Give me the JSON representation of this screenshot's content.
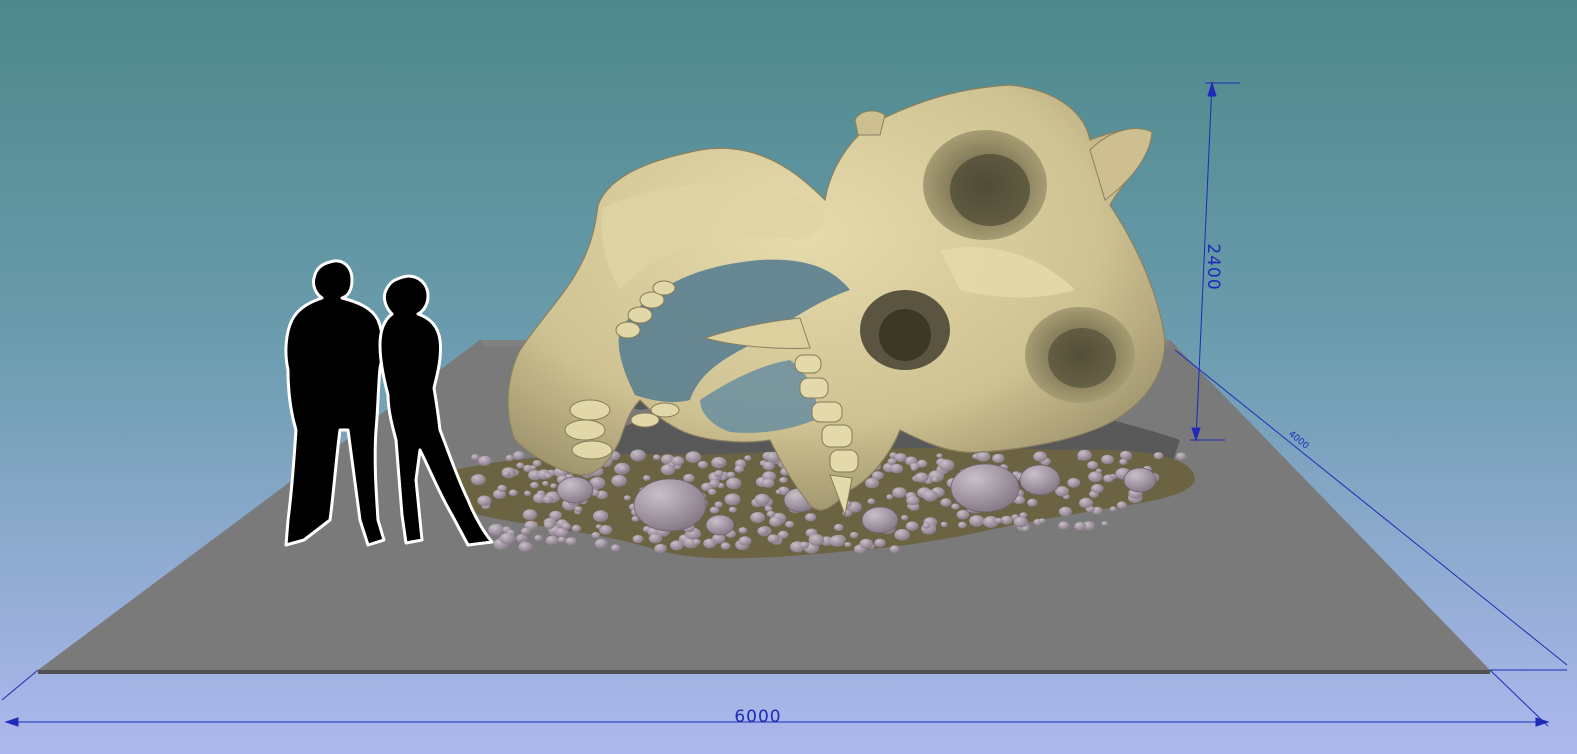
{
  "dimensions": {
    "width_label": "6000",
    "height_label": "2400",
    "depth_label": "4000"
  },
  "colors": {
    "sky_top": "#4f8a8d",
    "sky_bottom": "#aab6ec",
    "platform_top": "#7a7a7a",
    "platform_front": "#5c5c5c",
    "bone": "#d6c99a",
    "bone_shadow": "#8f8663",
    "pebble": "#a69aa6",
    "dimension_line": "#1d2bb8",
    "silhouette": "#000000"
  },
  "icons": {
    "figures": "human-scale-silhouette-icon",
    "sculpture": "giant-skull-sculpture"
  }
}
